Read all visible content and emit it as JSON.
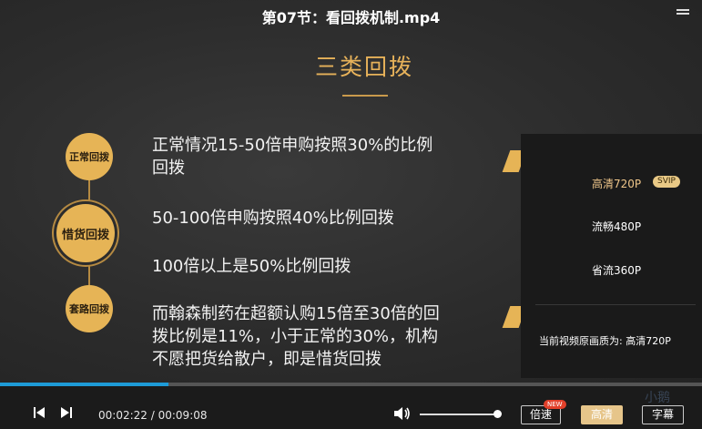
{
  "video": {
    "title": "第07节：看回拨机制.mp4"
  },
  "slide": {
    "title": "三类回拨",
    "badges": [
      "正常回拨",
      "惜货回拨",
      "套路回拨"
    ],
    "lines": [
      "正常情况15-50倍申购按照30%的比例",
      "回拨",
      "50-100倍申购按照40%比例回拨",
      "100倍以上是50%比例回拨",
      "而翰森制药在超额认购15倍至30倍的回",
      "拨比例是11%，小于正常的30%，机构",
      "不愿把货给散户，即是惜货回拨"
    ]
  },
  "quality_menu": {
    "options": [
      "高清720P",
      "流畅480P",
      "省流360P"
    ],
    "selected": "高清720P",
    "svip_badge": "SVIP",
    "current_label": "当前视频原画质为: 高清720P"
  },
  "player": {
    "current_time": "00:02:22",
    "separator": "/",
    "duration": "00:09:08",
    "progress": 0.24,
    "volume": 0.95,
    "speed_label": "倍速",
    "new_badge": "NEW",
    "quality_label": "高清",
    "subtitle_label": "字幕",
    "watermark": "小鹅"
  },
  "colors": {
    "accent_gold": "#e6b456",
    "progress_blue": "#1e9bd7",
    "quality_button": "#e6c58a"
  }
}
